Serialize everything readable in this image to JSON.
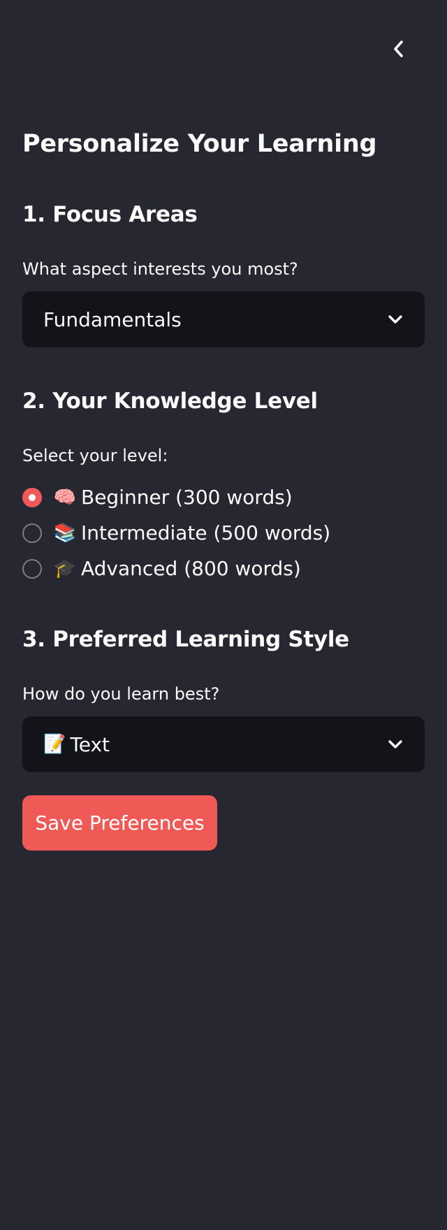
{
  "sidebar": {
    "title": "Personalize Your Learning",
    "collapse_icon": "chevron-left-icon"
  },
  "focus": {
    "heading": "1. Focus Areas",
    "question": "What aspect interests you most?",
    "selected": "Fundamentals"
  },
  "level": {
    "heading": "2. Your Knowledge Level",
    "question": "Select your level:",
    "options": [
      {
        "icon": "🧠",
        "label": "Beginner (300 words)",
        "checked": true
      },
      {
        "icon": "📚",
        "label": "Intermediate (500 words)",
        "checked": false
      },
      {
        "icon": "🎓",
        "label": "Advanced (800 words)",
        "checked": false
      }
    ]
  },
  "style": {
    "heading": "3. Preferred Learning Style",
    "question": "How do you learn best?",
    "selected_icon": "📝",
    "selected": "Text"
  },
  "save_button": {
    "label": "Save Preferences"
  },
  "colors": {
    "background": "#262730",
    "input_background": "#13141a",
    "accent": "#ef5a57",
    "text": "#fafafa"
  }
}
